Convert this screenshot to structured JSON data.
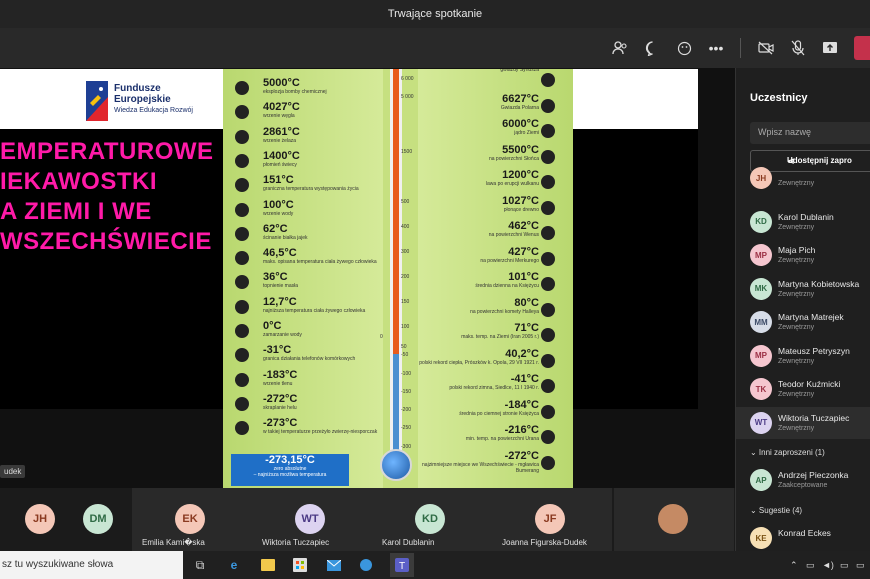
{
  "window": {
    "title": "Trwające spotkanie"
  },
  "slide": {
    "logo_line1": "Fundusze",
    "logo_line2": "Europejskie",
    "logo_sub": "Wiedza Edukacja Rozwój",
    "headline": [
      "EMPERATUROWE",
      "IEKAWOSTKI",
      "A ZIEMI I WE",
      "WSZECHŚWIECIE"
    ],
    "scale_right": [
      "6 000",
      "5 000",
      "1500",
      "500",
      "400",
      "300",
      "200",
      "150",
      "100",
      "50",
      "0",
      "-50",
      "-100",
      "-150",
      "-200",
      "-250",
      "-300"
    ],
    "left_entries": [
      {
        "t": "5000°C",
        "d": "eksplozja bomby chemicznej"
      },
      {
        "t": "4027°C",
        "d": "wrzenie węgla"
      },
      {
        "t": "2861°C",
        "d": "wrzenie żelaza"
      },
      {
        "t": "1400°C",
        "d": "płomień świecy"
      },
      {
        "t": "151°C",
        "d": "graniczna temperatura występowania życia"
      },
      {
        "t": "100°C",
        "d": "wrzenie wody"
      },
      {
        "t": "62°C",
        "d": "ścinanie białka jajek"
      },
      {
        "t": "46,5°C",
        "d": "maks. opisana temperatura ciała żywego człowieka"
      },
      {
        "t": "36°C",
        "d": "topnienie masła"
      },
      {
        "t": "12,7°C",
        "d": "najniższa temperatura ciała żywego człowieka"
      },
      {
        "t": "0°C",
        "d": "zamarzanie wody"
      },
      {
        "t": "-31°C",
        "d": "granica działania telefonów komórkowych"
      },
      {
        "t": "-183°C",
        "d": "wrzenie tlenu"
      },
      {
        "t": "-272°C",
        "d": "skraplanie helu"
      },
      {
        "t": "-273°C",
        "d": "w takiej temperaturze przeżyło zwierzę-niesporczak"
      }
    ],
    "absolute_zero": {
      "t": "-273,15°C",
      "d1": "zero absolutne",
      "d2": "– najniższa możliwa temperatura"
    },
    "right_entries": [
      {
        "t": "",
        "d": "gwiazdy Syriusza"
      },
      {
        "t": "6627°C",
        "d": "Gwiazda Polarna"
      },
      {
        "t": "6000°C",
        "d": "jądro Ziemi"
      },
      {
        "t": "5500°C",
        "d": "na powierzchni Słońca"
      },
      {
        "t": "1200°C",
        "d": "lawa po erupcji wulkanu"
      },
      {
        "t": "1027°C",
        "d": "płonące drewno"
      },
      {
        "t": "462°C",
        "d": "na powierzchni Wenus"
      },
      {
        "t": "427°C",
        "d": "na powierzchni Merkurego"
      },
      {
        "t": "101°C",
        "d": "średnia dzienna na Księżycu"
      },
      {
        "t": "80°C",
        "d": "na powierzchni komety Halleya"
      },
      {
        "t": "71°C",
        "d": "maks. temp. na Ziemi (Iran 2005 r.)"
      },
      {
        "t": "40,2°C",
        "d": "polski rekord ciepła, Prószków k. Opola, 29 VII 1921 r."
      },
      {
        "t": "-41°C",
        "d": "polski rekord zimna, Siedlce, 11 I 1940 r."
      },
      {
        "t": "-184°C",
        "d": "średnia po ciemnej stronie Księżyca"
      },
      {
        "t": "-216°C",
        "d": "min. temp. na powierzchni Urana"
      },
      {
        "t": "-272°C",
        "d": "najzimniejsze miejsce we Wszechświecie - mgławica Bumerang"
      }
    ],
    "presenter_chip": "udek"
  },
  "participants_panel": {
    "title": "Uczestnicy",
    "search_placeholder": "Wpisz nazwę",
    "share_label": "Udostępnij zapro",
    "people": [
      {
        "initials": "JH",
        "name": "",
        "role": "Zewnętrzny",
        "color": "#f4c7b7",
        "fg": "#8a3a20"
      },
      {
        "initials": "KD",
        "name": "Karol Dublanin",
        "role": "Zewnętrzny",
        "color": "#c8e6d3",
        "fg": "#2f6b45"
      },
      {
        "initials": "MP",
        "name": "Maja Pich",
        "role": "Zewnętrzny",
        "color": "#f5c6cf",
        "fg": "#9b2f44"
      },
      {
        "initials": "MK",
        "name": "Martyna Kobietowska",
        "role": "Zewnętrzny",
        "color": "#c8e6d3",
        "fg": "#2f6b45"
      },
      {
        "initials": "MM",
        "name": "Martyna Matrejek",
        "role": "Zewnętrzny",
        "color": "#d7dde8",
        "fg": "#3b4a66"
      },
      {
        "initials": "MP",
        "name": "Mateusz Petryszyn",
        "role": "Zewnętrzny",
        "color": "#f5c6cf",
        "fg": "#9b2f44"
      },
      {
        "initials": "TK",
        "name": "Teodor Kuźmicki",
        "role": "Zewnętrzny",
        "color": "#f5c6cf",
        "fg": "#9b2f44"
      },
      {
        "initials": "WT",
        "name": "Wiktoria Tuczapiec",
        "role": "Zewnętrzny",
        "color": "#dcd3f0",
        "fg": "#4b3a85"
      }
    ],
    "invited_header": "Inni zaproszeni (1)",
    "invited": [
      {
        "initials": "AP",
        "name": "Andrzej Pieczonka",
        "role": "Zaakceptowane",
        "color": "#c8e6d3",
        "fg": "#2f6b45"
      }
    ],
    "suggest_header": "Sugestie (4)",
    "suggest": [
      {
        "initials": "KE",
        "name": "Konrad Eckes",
        "role": "",
        "color": "#f7e0b5",
        "fg": "#7a5214"
      }
    ]
  },
  "video_dock": {
    "tiles": [
      {
        "initials": "JH",
        "name": "",
        "color": "#f4c7b7",
        "fg": "#8a3a20"
      },
      {
        "initials": "DM",
        "name": "",
        "color": "#c8e6d3",
        "fg": "#2f6b45"
      },
      {
        "initials": "EK",
        "name": "Emilia Kami�ska",
        "color": "#f4c7b7",
        "fg": "#8a3a20"
      },
      {
        "initials": "WT",
        "name": "Wiktoria Tuczapiec",
        "color": "#dcd3f0",
        "fg": "#4b3a85"
      },
      {
        "initials": "KD",
        "name": "Karol Dublanin",
        "color": "#c8e6d3",
        "fg": "#2f6b45"
      },
      {
        "initials": "JF",
        "name": "Joanna Figurska-Dudek",
        "color": "#f4c7b7",
        "fg": "#8a3a20"
      }
    ]
  },
  "taskbar": {
    "search_text": "sz tu wyszukiwane słowa"
  }
}
